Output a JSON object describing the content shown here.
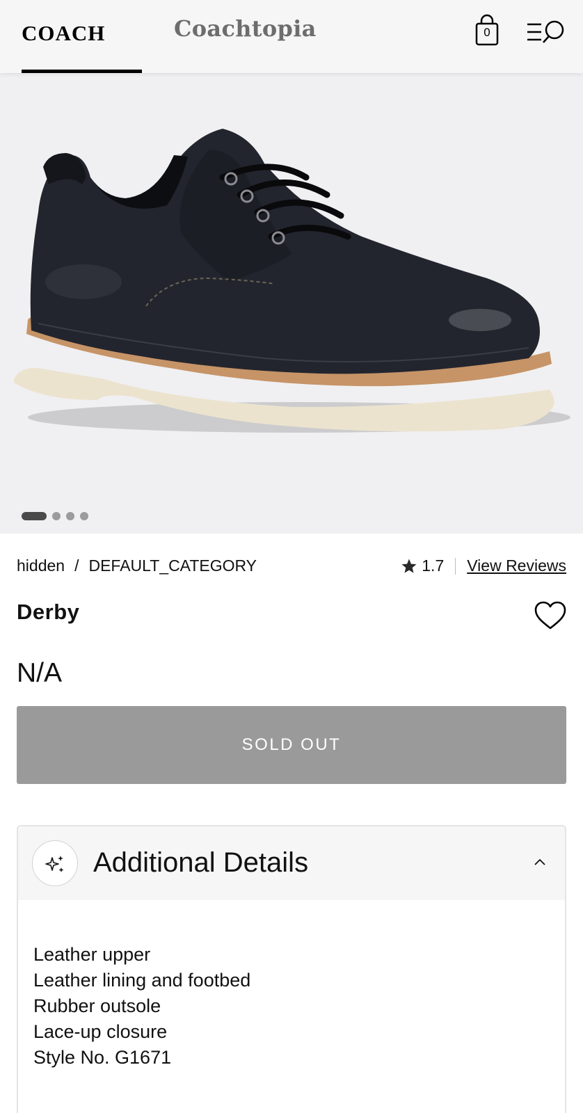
{
  "header": {
    "brand": "COACH",
    "secondary_tab": "Coachtopia",
    "bag_count": "0",
    "icons": [
      "shopping-bag-icon",
      "menu-search-icon"
    ]
  },
  "hero": {
    "image": "black leather derby shoe with cream sole",
    "carousel_slides": 4,
    "active_slide": 1
  },
  "breadcrumb": {
    "items": [
      "hidden",
      "DEFAULT_CATEGORY"
    ],
    "separator": "/"
  },
  "rating": {
    "value": "1.7",
    "reviews_link": "View Reviews"
  },
  "product": {
    "title": "Derby",
    "price": "N/A",
    "cta_label": "SOLD OUT"
  },
  "details": {
    "heading": "Additional Details",
    "lines": [
      "Leather upper",
      "Leather lining and footbed",
      "Rubber outsole",
      "Lace-up closure",
      "Style No. G1671"
    ]
  },
  "colors": {
    "header_bg": "#f6f6f6",
    "hero_bg": "#f0f0f2",
    "soldout_bg": "#9a9a9a",
    "text": "#111111",
    "secondary_tab": "#6d6d6d"
  }
}
